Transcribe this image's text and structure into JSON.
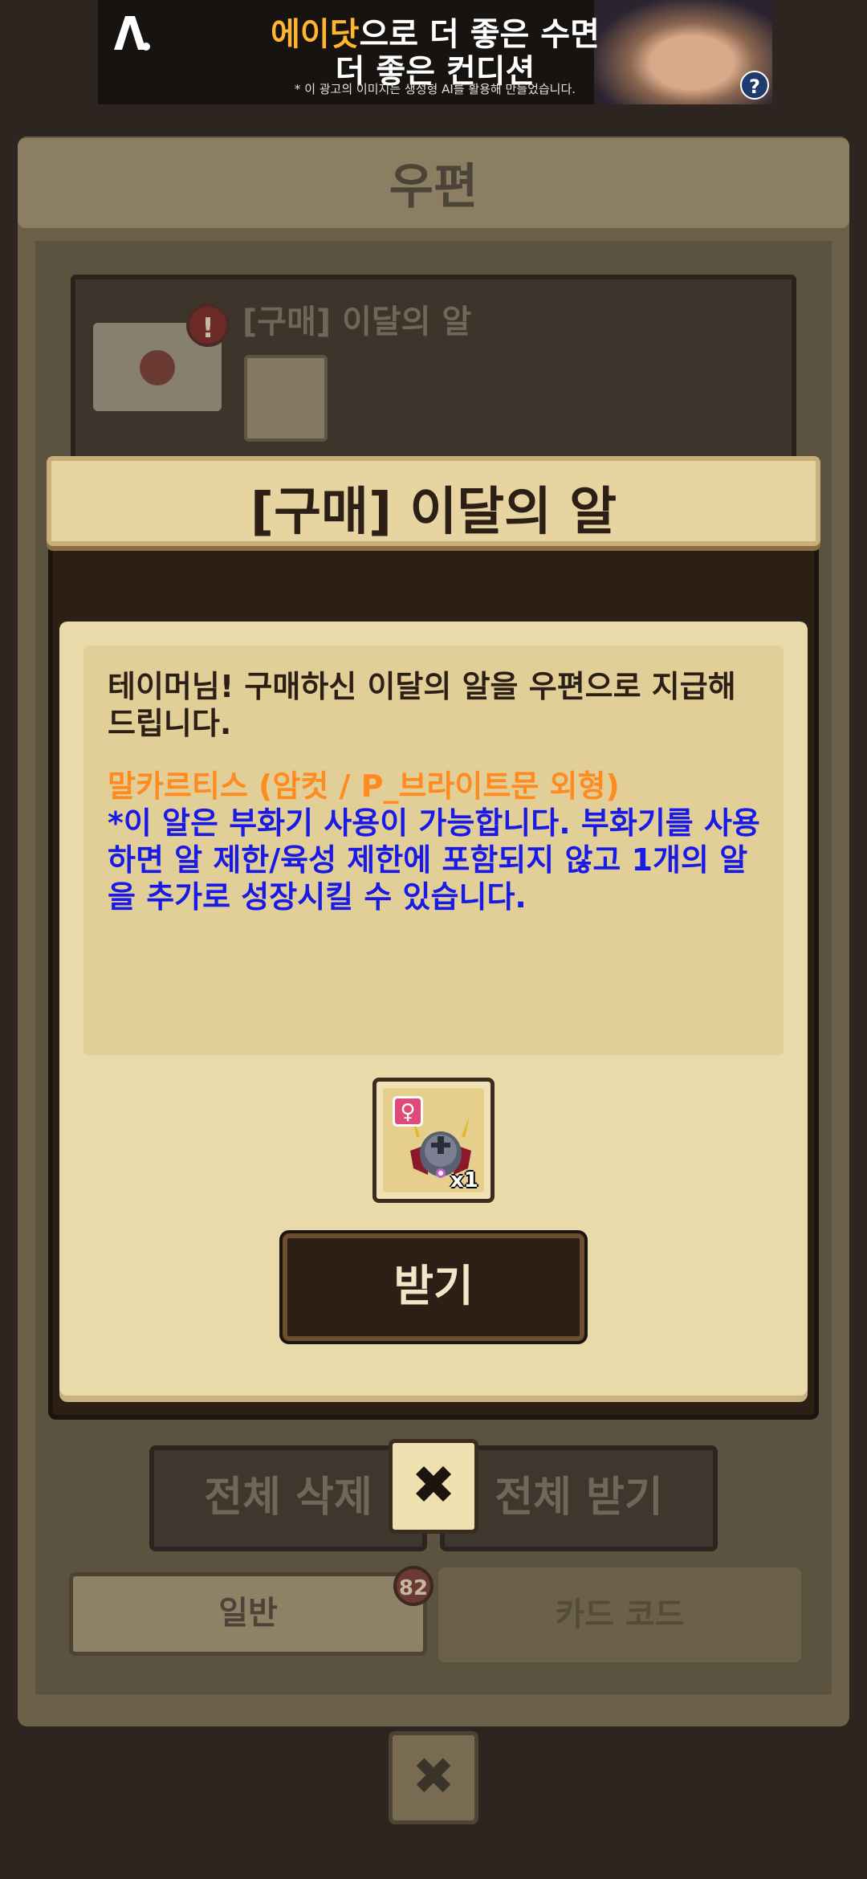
{
  "ad": {
    "line1_highlight": "에이닷",
    "line1_rest": "으로 더 좋은 수면",
    "line2": "더 좋은 컨디션",
    "note": "* 이 광고의 이미지는 생성형 AI를 활용해 만들었습니다.",
    "help_icon": "?"
  },
  "mail": {
    "title": "우편",
    "item": {
      "title": "[구매] 이달의 알",
      "alert": "!"
    },
    "delete_all": "전체 삭제",
    "receive_all": "전체 받기",
    "tabs": [
      {
        "label": "일반",
        "badge": "82"
      },
      {
        "label": "카드 코드"
      }
    ],
    "close_icon": "✖"
  },
  "modal": {
    "title": "[구매] 이달의 알",
    "intro": "테이머님! 구매하신 이달의 알을 우편으로 지급해 드립니다.",
    "highlight": "말카르티스 (암컷 / P_브라이트문 외형)",
    "note": "*이 알은 부화기 사용이 가능합니다. 부화기를 사용하면 알 제한/육성 제한에 포함되지 않고 1개의 알을 추가로 성장시킬 수 있습니다.",
    "item": {
      "gender_icon": "♀",
      "quantity": "x1"
    },
    "receive_button": "받기",
    "close_icon": "✖"
  },
  "colors": {
    "background": "#2e2520",
    "modal_body": "#e9dba9",
    "highlight_text": "#ff8a1f",
    "note_text": "#1a1ae6",
    "button_dark": "#2b1f16"
  }
}
